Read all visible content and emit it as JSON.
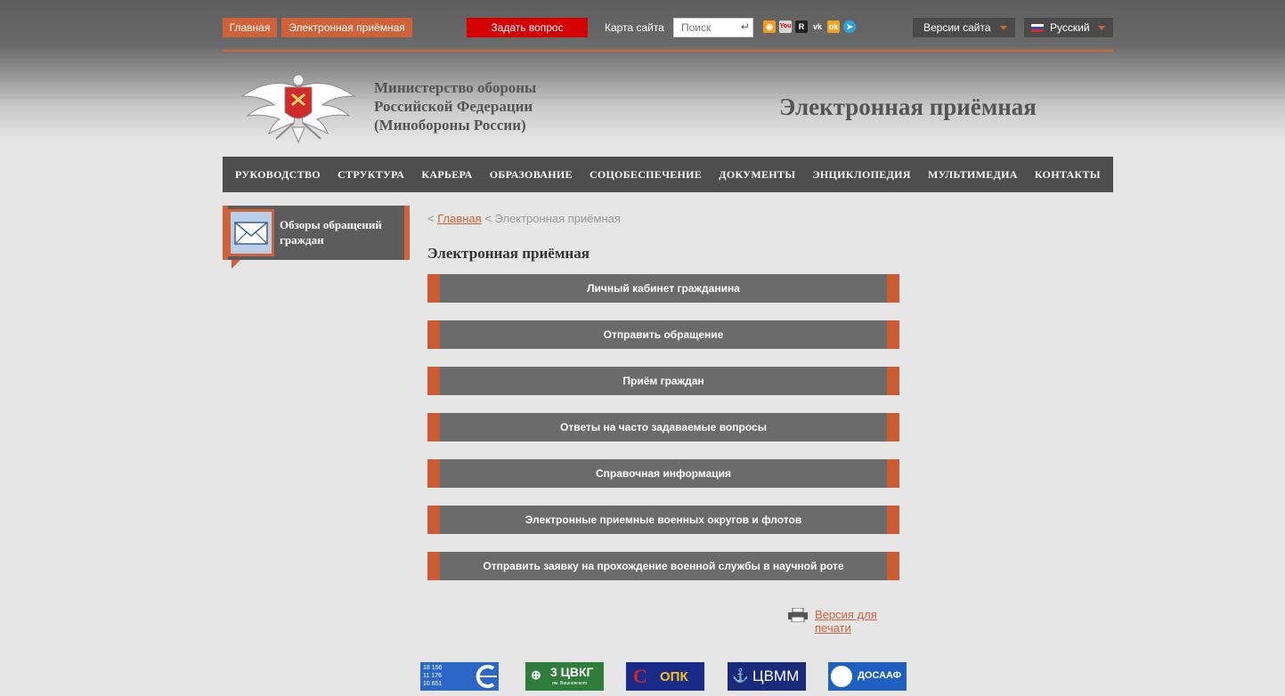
{
  "topbar": {
    "home": "Главная",
    "reception": "Электронная приёмная",
    "ask": "Задать вопрос",
    "sitemap": "Карта сайта",
    "search_placeholder": "Поиск",
    "versions": "Версии сайта",
    "language": "Русский",
    "social": [
      "rss-icon",
      "youtube-icon",
      "rutube-icon",
      "vk-icon",
      "odnoklassniki-icon",
      "telegram-icon"
    ]
  },
  "header": {
    "ministry": [
      "Министерство обороны",
      "Российской Федерации",
      "(Минобороны России)"
    ],
    "title": "Электронная приёмная"
  },
  "nav": [
    "РУКОВОДСТВО",
    "СТРУКТУРА",
    "КАРЬЕРА",
    "ОБРАЗОВАНИЕ",
    "СОЦОБЕСПЕЧЕНИЕ",
    "ДОКУМЕНТЫ",
    "ЭНЦИКЛОПЕДИЯ",
    "МУЛЬТИМЕДИА",
    "КОНТАКТЫ"
  ],
  "sidebar": {
    "label_line1": "Обзоры обращений",
    "label_line2": "граждан"
  },
  "breadcrumb": {
    "sep": "<",
    "home": "Главная",
    "current": "Электронная приёмная"
  },
  "page_title": "Электронная приёмная",
  "menu": [
    "Личный кабинет гражданина",
    "Отправить обращение",
    "Приём граждан",
    "Ответы на часто задаваемые вопросы",
    "Справочная информация",
    "Электронные приемные военных округов и флотов",
    "Отправить заявку на прохождение военной службы в научной роте"
  ],
  "print_link": "Версия для печати",
  "logos": {
    "l1_numbers": [
      "18 156",
      "11 176",
      "10 651"
    ],
    "l2": "3 ЦВКГ",
    "l2_sub": "им. Вишневского",
    "l3": "ОПК",
    "l4": "ЦВММ",
    "l5": "ДОСААФ"
  },
  "colors": {
    "accent": "#d0623a",
    "ask": "#d40000",
    "nav_bg": "#4d4d4d",
    "menu_bg": "#6b6b6b"
  }
}
